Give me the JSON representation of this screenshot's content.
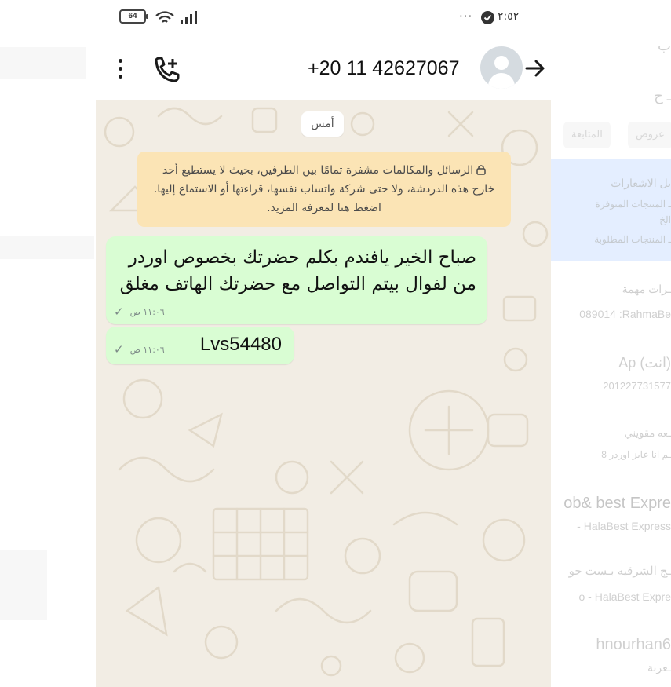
{
  "status_bar": {
    "battery": "64",
    "dots": "···",
    "time": "٢:٥٢"
  },
  "header": {
    "contact": "+20 11 42627067"
  },
  "chat": {
    "date_chip": "أمس",
    "e2e_notice": "الرسائل والمكالمات مشفرة تمامًا بين الطرفين، بحيث لا يستطيع أحد خارج هذه الدردشة، ولا حتى شركة واتساب نفسها، قراءتها أو الاستماع إليها. اضغط هنا لمعرفة المزيد.",
    "messages": [
      {
        "text": "صباح الخير يافندم بكلم حضرتك بخصوص اوردر من لفوال بيتم التواصل مع حضرتك الهاتف مغلق",
        "time": "١١:٠٦ ص",
        "status": "✓"
      },
      {
        "text": "Lvs54480",
        "time": "١١:٠٦ ص",
        "status": "✓"
      }
    ]
  },
  "background_page": {
    "line_1": "ب",
    "line_2": "ـ ح",
    "pill_1": "المتابعة",
    "pill_2": "عروض",
    "blue_1": "بل الاشعارات",
    "blue_2": "ـ المنتجات المتوفرة",
    "blue_3": "الخ",
    "blue_4": "ـ المنتجات المطلوبة",
    "line_3": "ـرات مهمة",
    "line_4": "089014 :RahmaBe",
    "line_5": "Ap (انت)",
    "line_6": "201227731577",
    "line_7": "ـعه مقويني",
    "line_8": "ـم انا عايز اوردر 8",
    "line_9": "ob& best Expre",
    "line_10": "- HalaBest Express",
    "line_11": "ـج الشرقيه بـست جو",
    "line_12": "o - HalaBest Expre",
    "line_13": "hnourhan6",
    "line_14": "ـعربة"
  }
}
